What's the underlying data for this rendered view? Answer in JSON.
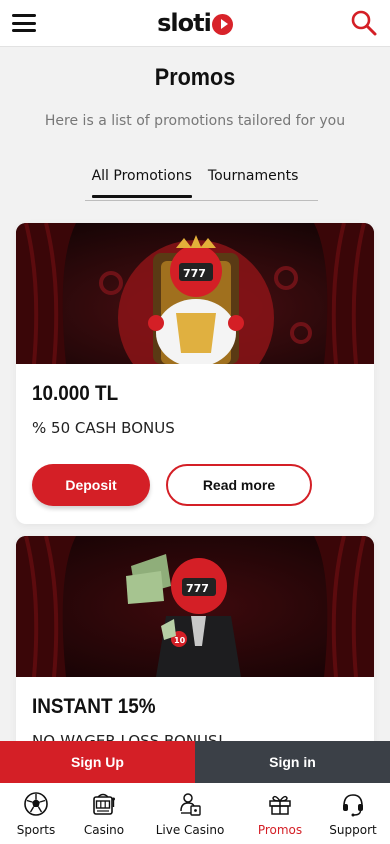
{
  "header": {
    "logo_text": "sloti",
    "menu_icon": "hamburger-menu-icon",
    "search_icon": "search-icon"
  },
  "page": {
    "title": "Promos",
    "subtitle": "Here is a list of promotions tailored for you"
  },
  "tabs": [
    {
      "label": "All Promotions",
      "active": true
    },
    {
      "label": "Tournaments",
      "active": false
    }
  ],
  "promotions": [
    {
      "amount": "10.000 TL",
      "bonus": "% 50 CASH BONUS",
      "deposit_label": "Deposit",
      "read_more_label": "Read more"
    },
    {
      "amount": "INSTANT 15%",
      "bonus": "NO-WAGER LOSS BONUS!"
    }
  ],
  "auth": {
    "signup_label": "Sign Up",
    "signin_label": "Sign in"
  },
  "bottom_nav": [
    {
      "label": "Sports",
      "icon": "soccer-ball-icon",
      "active": false
    },
    {
      "label": "Casino",
      "icon": "slot-machine-icon",
      "active": false
    },
    {
      "label": "Live Casino",
      "icon": "live-dealer-icon",
      "active": false
    },
    {
      "label": "Promos",
      "icon": "gift-icon",
      "active": true
    },
    {
      "label": "Support",
      "icon": "headset-icon",
      "active": false
    }
  ],
  "colors": {
    "brand_red": "#d41f26",
    "dark_button": "#3b4047",
    "background": "#f2f2f2"
  }
}
